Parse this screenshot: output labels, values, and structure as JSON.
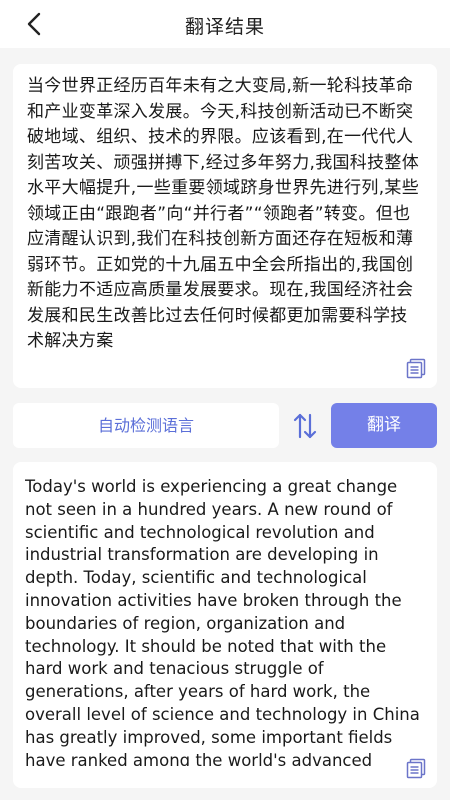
{
  "header": {
    "title": "翻译结果",
    "back_icon": "chevron-left-icon"
  },
  "source": {
    "text": "当今世界正经历百年未有之大变局,新一轮科技革命和产业变革深入发展。今天,科技创新活动已不断突破地域、组织、技术的界限。应该看到,在一代代人刻苦攻关、顽强拼搏下,经过多年努力,我国科技整体水平大幅提升,一些重要领域跻身世界先进行列,某些领域正由“跟跑者”向“并行者”“领跑者”转变。但也应清醒认识到,我们在科技创新方面还存在短板和薄弱环节。正如党的十九届五中全会所指出的,我国创新能力不适应高质量发展要求。现在,我国经济社会发展和民生改善比过去任何时候都更加需要科学技术解决方案",
    "copy_icon": "copy-icon"
  },
  "controls": {
    "language_label": "自动检测语言",
    "swap_icon": "swap-arrows-icon",
    "translate_label": "翻译"
  },
  "target": {
    "text": "Today's world is experiencing a great change not seen in a hundred years. A new round of scientific and technological revolution and industrial transformation are developing in depth. Today, scientific and technological innovation activities have broken through the boundaries of region, organization and technology. It should be noted that with the hard work and tenacious struggle of generations, after years of hard work, the overall level of science and technology in China has greatly improved, some important fields have ranked among the world's advanced ranks, and some fields are changing",
    "copy_icon": "copy-icon"
  },
  "colors": {
    "accent": "#7480e8",
    "accent_text": "#5b6fd8",
    "background": "#f5f5f5",
    "card": "#ffffff"
  }
}
